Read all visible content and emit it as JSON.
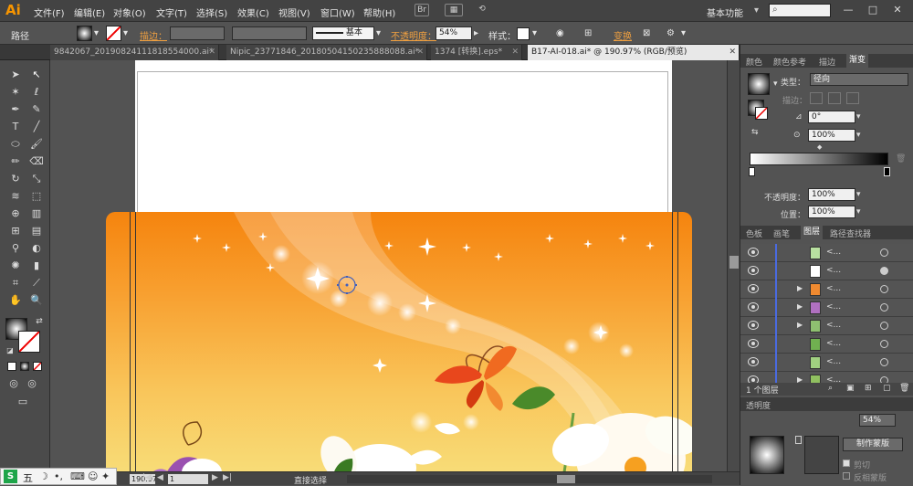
{
  "app": {
    "logo": "Ai",
    "menus": [
      "文件(F)",
      "编辑(E)",
      "对象(O)",
      "文字(T)",
      "选择(S)",
      "效果(C)",
      "视图(V)",
      "窗口(W)",
      "帮助(H)"
    ],
    "workspace": "基本功能",
    "search_icon": "search-icon",
    "window_controls": [
      "—",
      "□",
      "✕"
    ]
  },
  "control_bar": {
    "selection_label": "路径",
    "stroke_label": "描边",
    "brush_label": "基本",
    "opacity_label": "不透明度",
    "opacity_value": "54%",
    "style_label": "样式",
    "transform_label": "变换"
  },
  "tabs": [
    {
      "label": "9842067_20190824111818554000.ai*"
    },
    {
      "label": "Nipic_23771846_20180504150235888088.ai*"
    },
    {
      "label": "1374 [转换].eps*"
    },
    {
      "label": "B17-AI-018.ai* @ 190.97% (RGB/预览)"
    }
  ],
  "status_bar": {
    "zoom": "190.97",
    "page": "1",
    "tool_name": "直接选择"
  },
  "panels": {
    "top_tabs": [
      "颜色",
      "颜色参考",
      "描边",
      "渐变"
    ],
    "gradient": {
      "type_label": "类型：",
      "type_value": "径向",
      "stroke_label": "描边：",
      "angle_value": "0°",
      "ratio_value": "100%",
      "opacity_label": "不透明度：",
      "opacity_value": "100%",
      "location_label": "位置：",
      "location_value": "100%"
    },
    "mid_tabs": [
      "色板",
      "画笔",
      "图层",
      "路径查找器"
    ],
    "layers": [
      {
        "name": "<...",
        "thumb": "#b8e0a0"
      },
      {
        "name": "<...",
        "thumb": "#ffffff"
      },
      {
        "name": "<...",
        "thumb": "#f08a30"
      },
      {
        "name": "<...",
        "thumb": "#b070c0"
      },
      {
        "name": "<...",
        "thumb": "#8ec070"
      },
      {
        "name": "<...",
        "thumb": "#70b050"
      },
      {
        "name": "<...",
        "thumb": "#a0d080"
      },
      {
        "name": "<...",
        "thumb": "#90c060"
      }
    ],
    "layer_count": "1 个图层",
    "mask_button": "制作蒙版",
    "clip_label": "剪切",
    "invert_label": "反相蒙版",
    "transparency_tab": "透明度",
    "transparency_value": "54%"
  },
  "ime_bar": {
    "label": "五"
  }
}
